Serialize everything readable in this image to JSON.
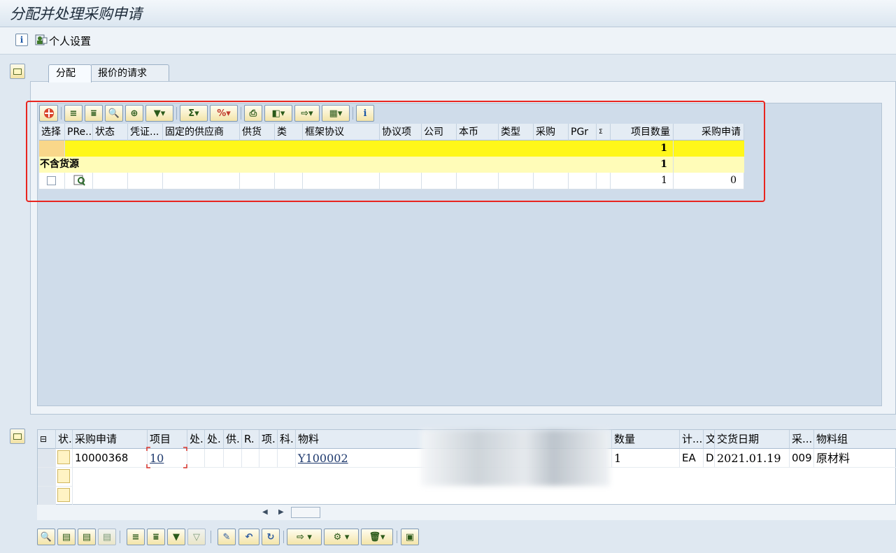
{
  "window": {
    "title": "分配并处理采购申请"
  },
  "appbar": {
    "personal_settings_label": "个人设置"
  },
  "tabs": [
    {
      "label": "分配"
    },
    {
      "label": "报价的请求"
    }
  ],
  "assign_grid": {
    "headers": [
      "选择",
      "PRe...",
      "状态",
      "凭证...",
      "固定的供应商",
      "供货",
      "类",
      "框架协议",
      "协议项",
      "公司",
      "本币",
      "类型",
      "采购",
      "PGr",
      "Σ",
      "项目数量",
      "采购申请"
    ],
    "total_row": {
      "item_qty": "1"
    },
    "group_row": {
      "label": "不含货源",
      "item_qty": "1"
    },
    "data_row": {
      "item_qty": "1",
      "purchase_req": "0"
    }
  },
  "item_grid": {
    "headers": [
      "状.",
      "采购申请",
      "项目",
      "处.",
      "处.",
      "供.",
      "R.",
      "项.",
      "科.",
      "物料",
      "数量",
      "计...",
      "文",
      "交货日期",
      "采...",
      "物料组"
    ],
    "rows": [
      {
        "purchase_req": "10000368",
        "item": "10",
        "material": "Y100002",
        "quantity": "1",
        "unit": "EA",
        "d": "D",
        "delivery_date": "2021.01.19",
        "purch_group": "009",
        "material_group": "原材料"
      }
    ]
  },
  "colors": {
    "highlight_yellow": "#fff71a",
    "group_yellow": "#fffcb8",
    "annotation_red": "#e8251f",
    "background": "#dfe8f1"
  }
}
